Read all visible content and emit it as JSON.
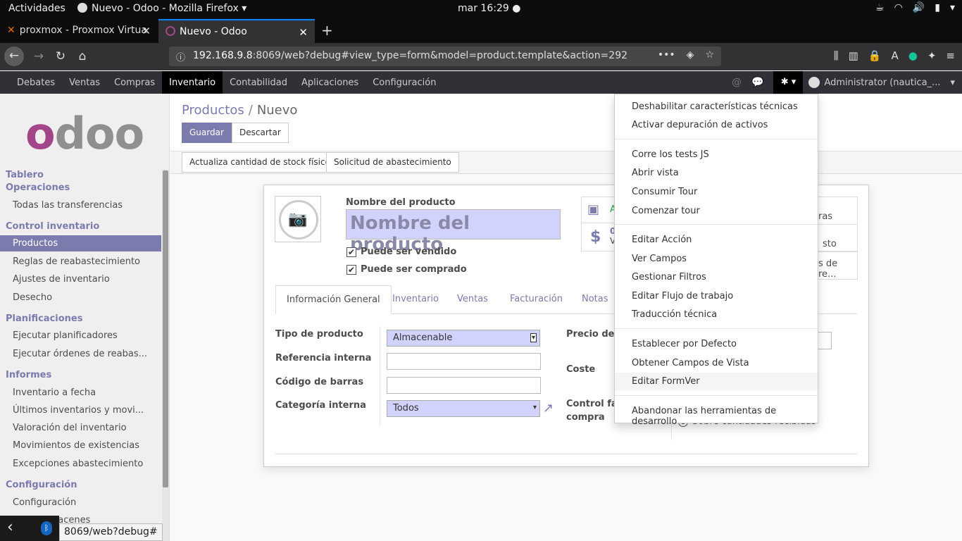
{
  "system": {
    "activities": "Actividades",
    "app_name": "Nuevo - Odoo - Mozilla Firefox",
    "clock": "mar 16:29"
  },
  "browser": {
    "tabs": [
      {
        "label": "proxmox - Proxmox Virtua"
      },
      {
        "label": "Nuevo - Odoo"
      }
    ],
    "url_host": "192.168.9.8",
    "url_rest": ":8069/web?debug#view_type=form&model=product.template&action=292",
    "status_link": "8069/web?debug#"
  },
  "odoo_menu": {
    "items": [
      "Debates",
      "Ventas",
      "Compras",
      "Inventario",
      "Contabilidad",
      "Aplicaciones",
      "Configuración"
    ],
    "active": "Inventario",
    "user": "Administrator (nautica_..."
  },
  "sidebar": {
    "sections": [
      {
        "title": "Tablero"
      },
      {
        "title": "Operaciones",
        "items": [
          "Todas las transferencias"
        ]
      },
      {
        "title": "Control inventario",
        "items": [
          "Productos",
          "Reglas de reabastecimiento",
          "Ajustes de inventario",
          "Desecho"
        ]
      },
      {
        "title": "Planificaciones",
        "items": [
          "Ejecutar planificadores",
          "Ejecutar órdenes de reabas..."
        ]
      },
      {
        "title": "Informes",
        "items": [
          "Inventario a fecha",
          "Últimos inventarios y movi...",
          "Valoración del inventario",
          "Movimientos de existencias",
          "Excepciones abastecimiento"
        ]
      },
      {
        "title": "Configuración",
        "items": [
          "Configuración",
          "almacenes"
        ]
      }
    ],
    "active_item": "Productos"
  },
  "breadcrumb": {
    "parent": "Productos",
    "current": "Nuevo"
  },
  "buttons": {
    "save": "Guardar",
    "discard": "Descartar",
    "update_stock": "Actualiza cantidad de stock físico",
    "procurement": "Solicitud de abastecimiento"
  },
  "form": {
    "name_label": "Nombre del producto",
    "name_placeholder": "Nombre del producto",
    "can_be_sold": "Puede ser vendido",
    "can_be_purchased": "Puede ser comprado",
    "smart_buttons": [
      "A",
      "0",
      "V",
      "ras",
      "sto",
      "s de re..."
    ],
    "tabs": [
      "Información General",
      "Inventario",
      "Ventas",
      "Facturación",
      "Notas"
    ],
    "active_tab": "Información General",
    "fields": {
      "product_type_label": "Tipo de producto",
      "product_type_value": "Almacenable",
      "internal_ref_label": "Referencia interna",
      "barcode_label": "Código de barras",
      "category_label": "Categoría interna",
      "category_value": "Todos",
      "sale_price_label": "Precio de v",
      "cost_label": "Coste",
      "purchase_control_label_1": "Control fac",
      "purchase_control_label_2": "compra",
      "purchase_control_option": "Sobre cantidades recibidas"
    }
  },
  "debug_menu": {
    "groups": [
      [
        "Deshabilitar características técnicas",
        "Activar depuración de activos"
      ],
      [
        "Corre los tests JS",
        "Abrir vista",
        "Consumir Tour",
        "Comenzar tour"
      ],
      [
        "Editar Acción",
        "Ver Campos",
        "Gestionar Filtros",
        "Editar Flujo de trabajo",
        "Traducción técnica"
      ],
      [
        "Establecer por Defecto",
        "Obtener Campos de Vista",
        "Editar FormVer"
      ],
      [
        "Abandonar las herramientas de desarrollo"
      ]
    ],
    "hovered": "Editar FormVer"
  },
  "colors": {
    "odoo_primary": "#7c7bad",
    "odoo_logo": "#a24689",
    "firefox_accent": "#0a84ff"
  }
}
